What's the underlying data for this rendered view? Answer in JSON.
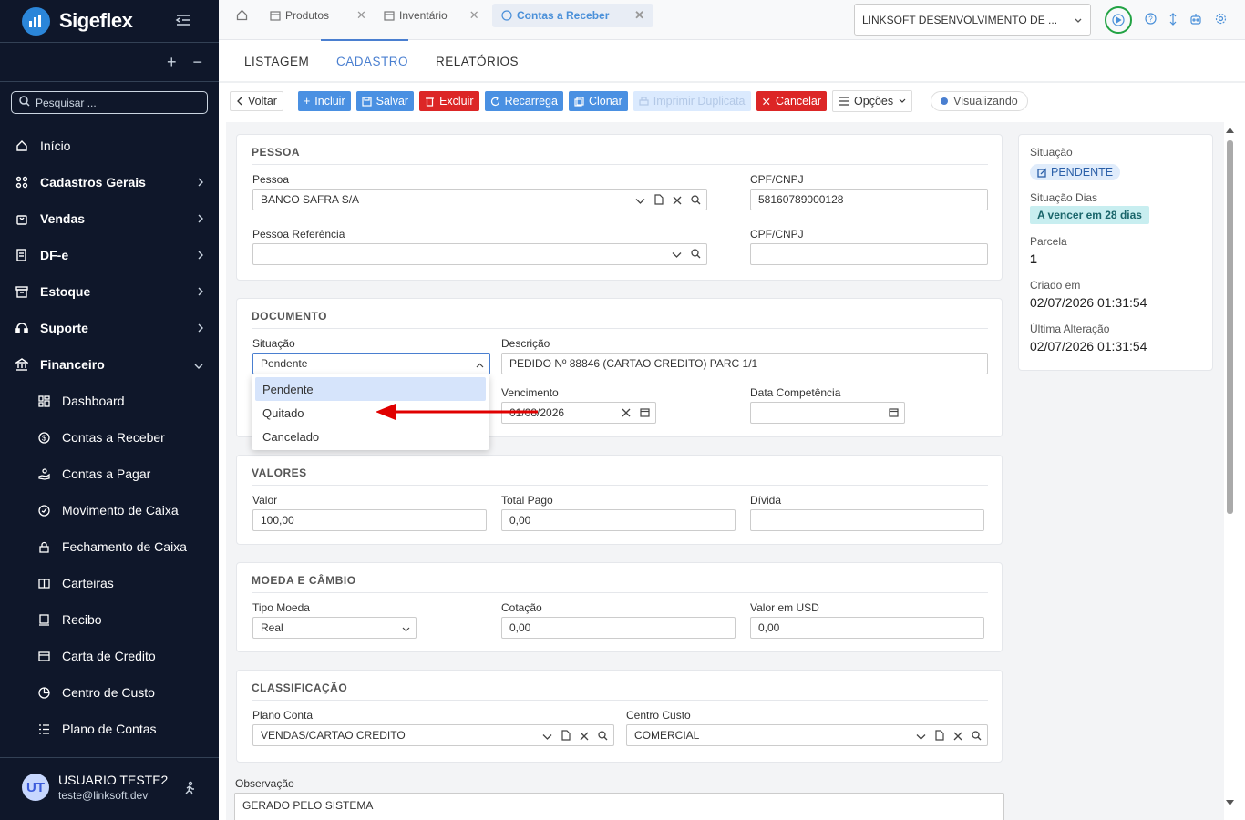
{
  "app": {
    "name": "Sigeflex",
    "search_placeholder": "Pesquisar ..."
  },
  "sidebar": {
    "items": [
      {
        "label": "Início",
        "bold": false
      },
      {
        "label": "Cadastros Gerais",
        "bold": true
      },
      {
        "label": "Vendas",
        "bold": true
      },
      {
        "label": "DF-e",
        "bold": true
      },
      {
        "label": "Estoque",
        "bold": true
      },
      {
        "label": "Suporte",
        "bold": true
      },
      {
        "label": "Financeiro",
        "bold": true
      }
    ],
    "sub_items": [
      "Dashboard",
      "Contas a Receber",
      "Contas a Pagar",
      "Movimento de Caixa",
      "Fechamento de Caixa",
      "Carteiras",
      "Recibo",
      "Carta de Credito",
      "Centro de Custo",
      "Plano de Contas"
    ],
    "user": {
      "initials": "UT",
      "name": "USUARIO TESTE2",
      "email": "teste@linksoft.dev"
    }
  },
  "tabs": [
    {
      "label": "Produtos"
    },
    {
      "label": "Inventário"
    },
    {
      "label": "Contas a Receber"
    }
  ],
  "company": "LINKSOFT DESENVOLVIMENTO DE ...",
  "subtabs": [
    "LISTAGEM",
    "CADASTRO",
    "RELATÓRIOS"
  ],
  "toolbar": {
    "back": "Voltar",
    "add": "Incluir",
    "save": "Salvar",
    "delete": "Excluir",
    "reload": "Recarrega",
    "clone": "Clonar",
    "print": "Imprimir Duplicata",
    "cancel": "Cancelar",
    "options": "Opções",
    "status": "Visualizando"
  },
  "pessoa": {
    "title": "PESSOA",
    "pessoa_label": "Pessoa",
    "pessoa_value": "BANCO SAFRA S/A",
    "cpf_label": "CPF/CNPJ",
    "cpf_value": "58160789000128",
    "ref_label": "Pessoa Referência",
    "ref_value": "",
    "cpf2_label": "CPF/CNPJ",
    "cpf2_value": ""
  },
  "documento": {
    "title": "DOCUMENTO",
    "situacao_label": "Situação",
    "situacao_value": "Pendente",
    "descricao_label": "Descrição",
    "descricao_value": "PEDIDO Nº 88846 (CARTAO CREDITO) PARC 1/1",
    "vencimento_label": "Vencimento",
    "vencimento_value": "01/08/2026",
    "competencia_label": "Data Competência",
    "competencia_value": "",
    "options": [
      "Pendente",
      "Quitado",
      "Cancelado"
    ]
  },
  "valores": {
    "title": "VALORES",
    "valor_label": "Valor",
    "valor_value": "100,00",
    "pago_label": "Total Pago",
    "pago_value": "0,00",
    "divida_label": "Dívida",
    "divida_value": ""
  },
  "moeda": {
    "title": "MOEDA E CÂMBIO",
    "tipo_label": "Tipo Moeda",
    "tipo_value": "Real",
    "cotacao_label": "Cotação",
    "cotacao_value": "0,00",
    "usd_label": "Valor em USD",
    "usd_value": "0,00"
  },
  "classificacao": {
    "title": "CLASSIFICAÇÃO",
    "plano_label": "Plano Conta",
    "plano_value": "VENDAS/CARTAO CREDITO",
    "centro_label": "Centro Custo",
    "centro_value": "COMERCIAL"
  },
  "observacao": {
    "label": "Observação",
    "value": "GERADO PELO SISTEMA"
  },
  "side": {
    "situacao_label": "Situação",
    "situacao_value": "PENDENTE",
    "dias_label": "Situação Dias",
    "dias_value": "A vencer em 28 dias",
    "parcela_label": "Parcela",
    "parcela_value": "1",
    "criado_label": "Criado em",
    "criado_value": "02/07/2026 01:31:54",
    "alteracao_label": "Última Alteração",
    "alteracao_value": "02/07/2026 01:31:54"
  },
  "colors": {
    "sidebar_bg": "#0f172a",
    "primary": "#4a90e2",
    "danger": "#dc2626",
    "annotation": "#e00000"
  }
}
